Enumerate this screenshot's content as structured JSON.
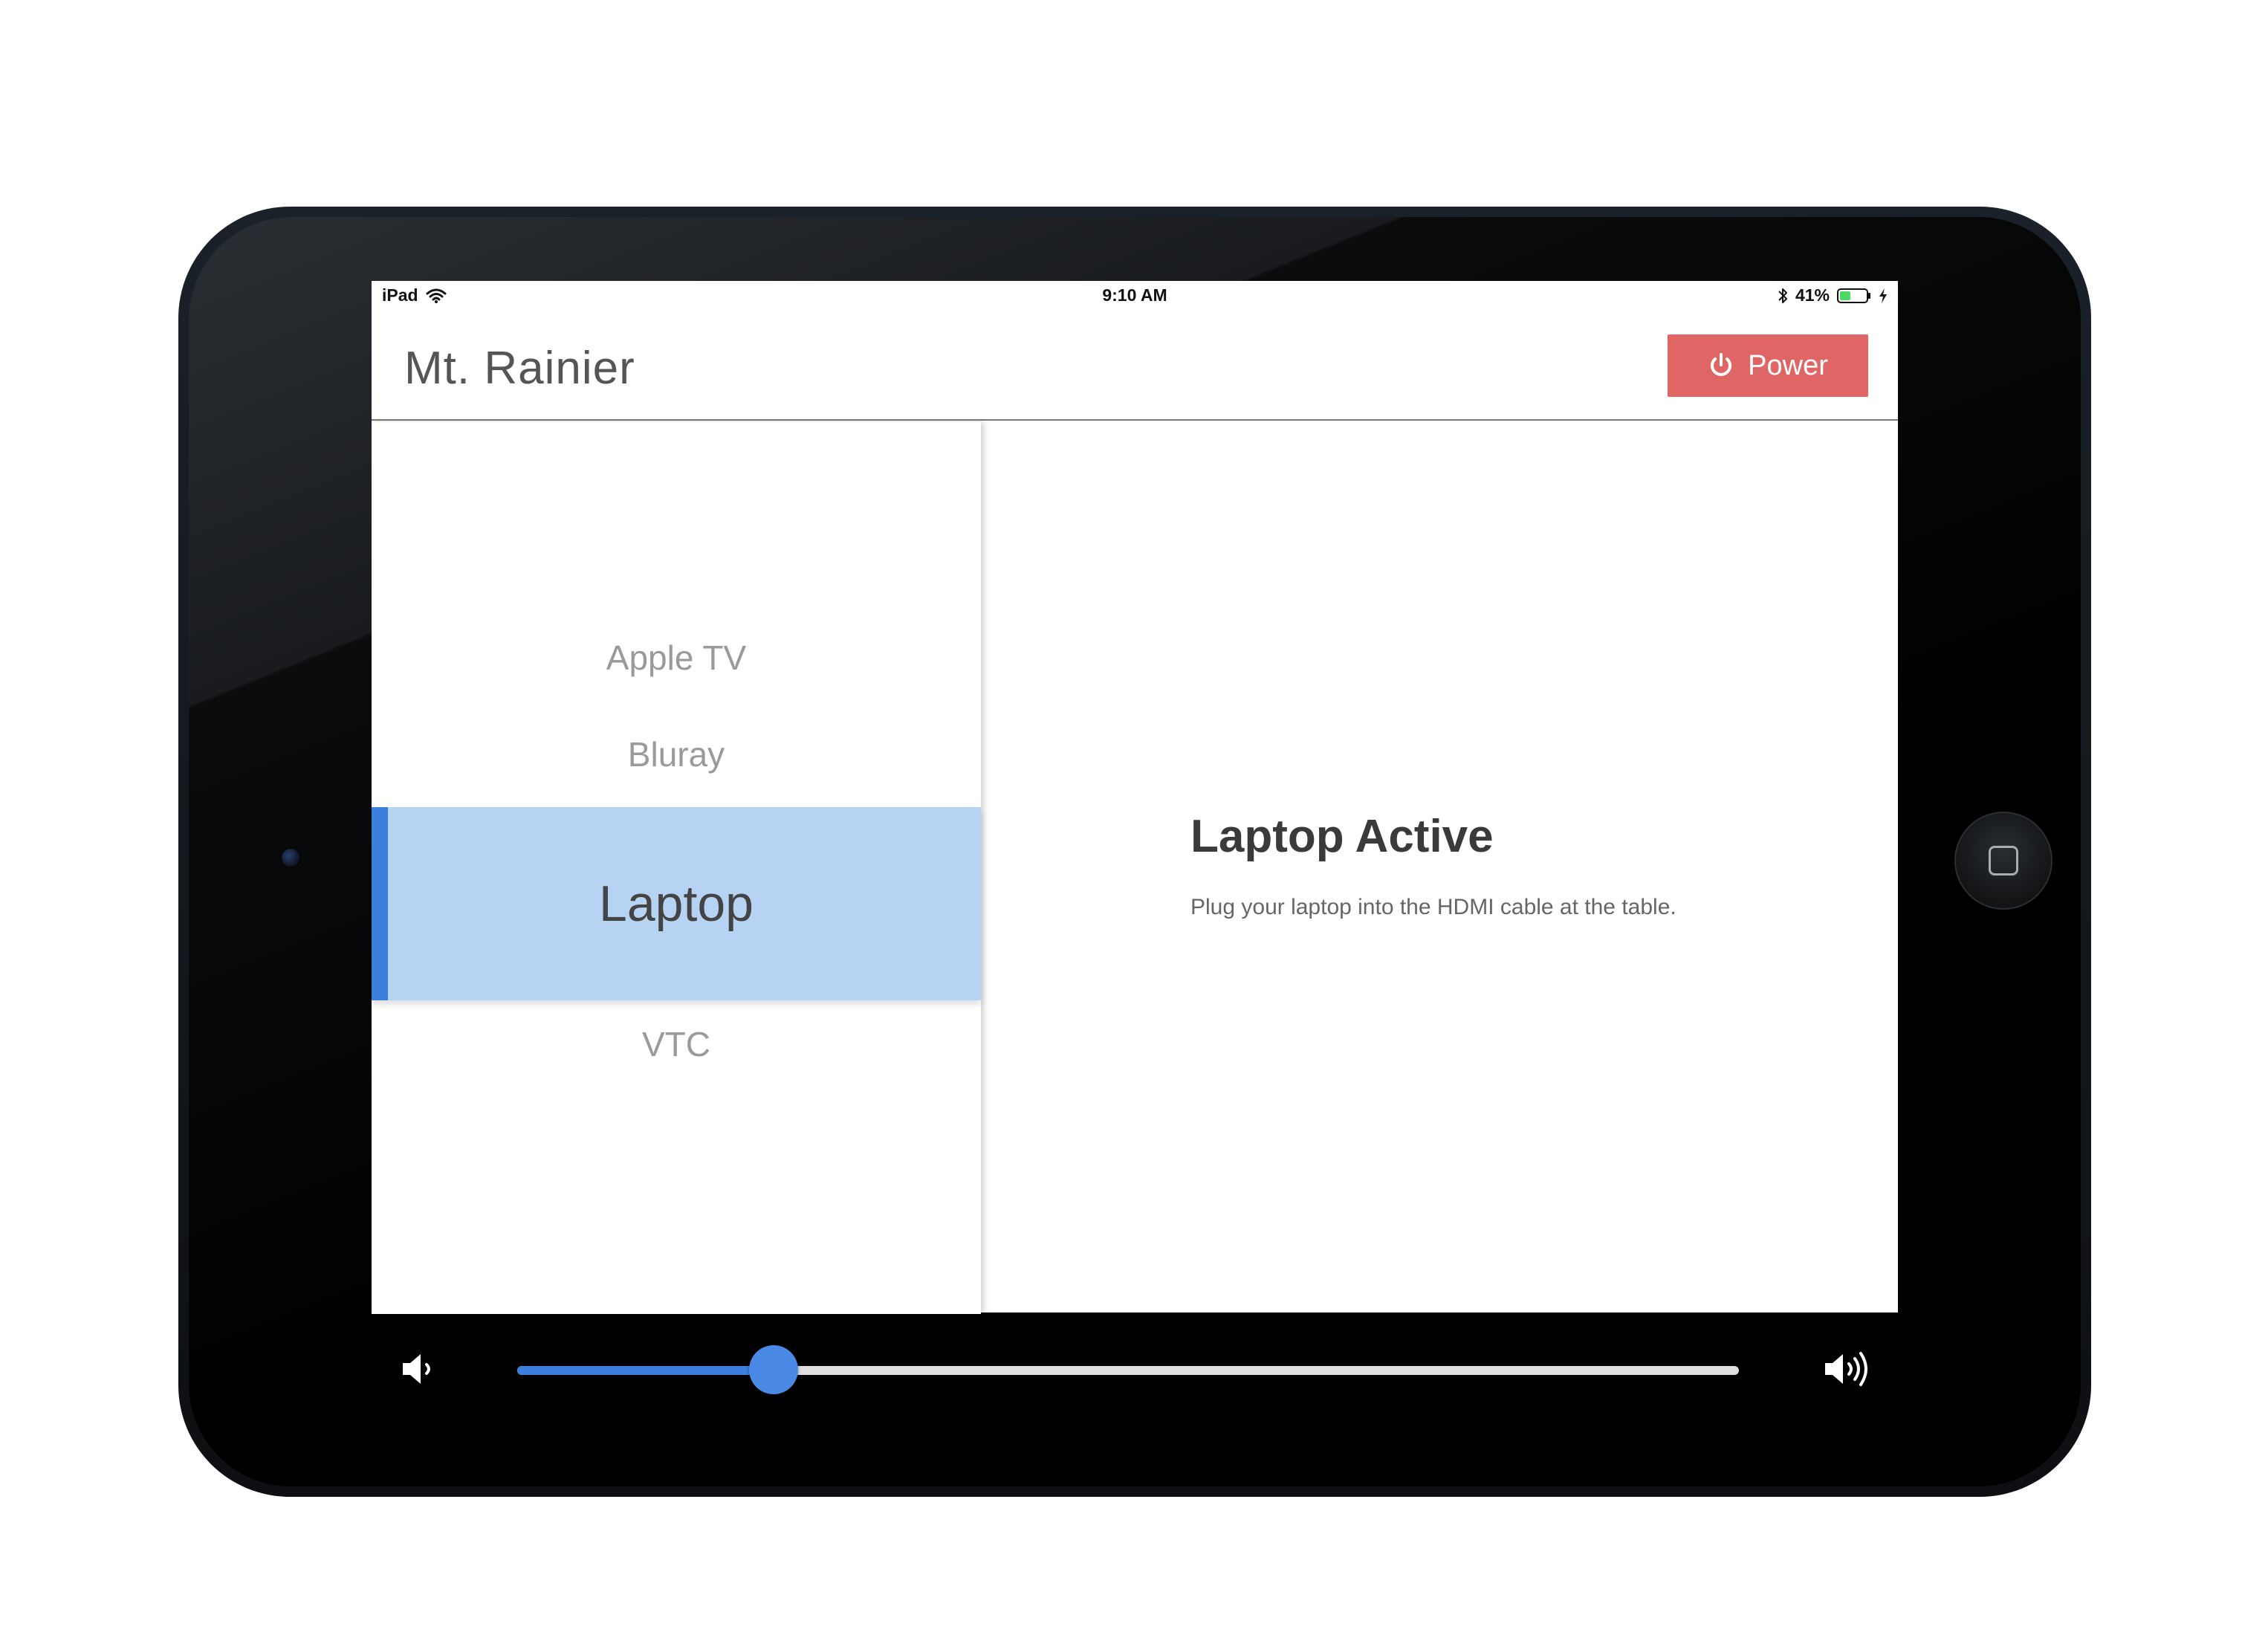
{
  "status_bar": {
    "device": "iPad",
    "time": "9:10 AM",
    "battery_percent": "41%",
    "battery_level": 0.41
  },
  "header": {
    "room_title": "Mt. Rainier",
    "power_label": "Power"
  },
  "sources": [
    {
      "label": "Apple TV",
      "active": false
    },
    {
      "label": "Bluray",
      "active": false
    },
    {
      "label": "Laptop",
      "active": true
    },
    {
      "label": "VTC",
      "active": false
    }
  ],
  "detail": {
    "title": "Laptop Active",
    "description": "Plug your laptop into the HDMI cable at the table."
  },
  "volume": {
    "level": 0.21
  },
  "colors": {
    "power_button": "#e06666",
    "active_source_bg": "#b7d3f4",
    "accent": "#3d7fdc",
    "battery": "#4cd964"
  },
  "icons": {
    "wifi": "wifi-icon",
    "bluetooth": "bluetooth-icon",
    "battery": "battery-icon",
    "charging": "charging-bolt-icon",
    "power": "power-icon",
    "volume_down": "volume-down-icon",
    "volume_up": "volume-up-icon"
  }
}
